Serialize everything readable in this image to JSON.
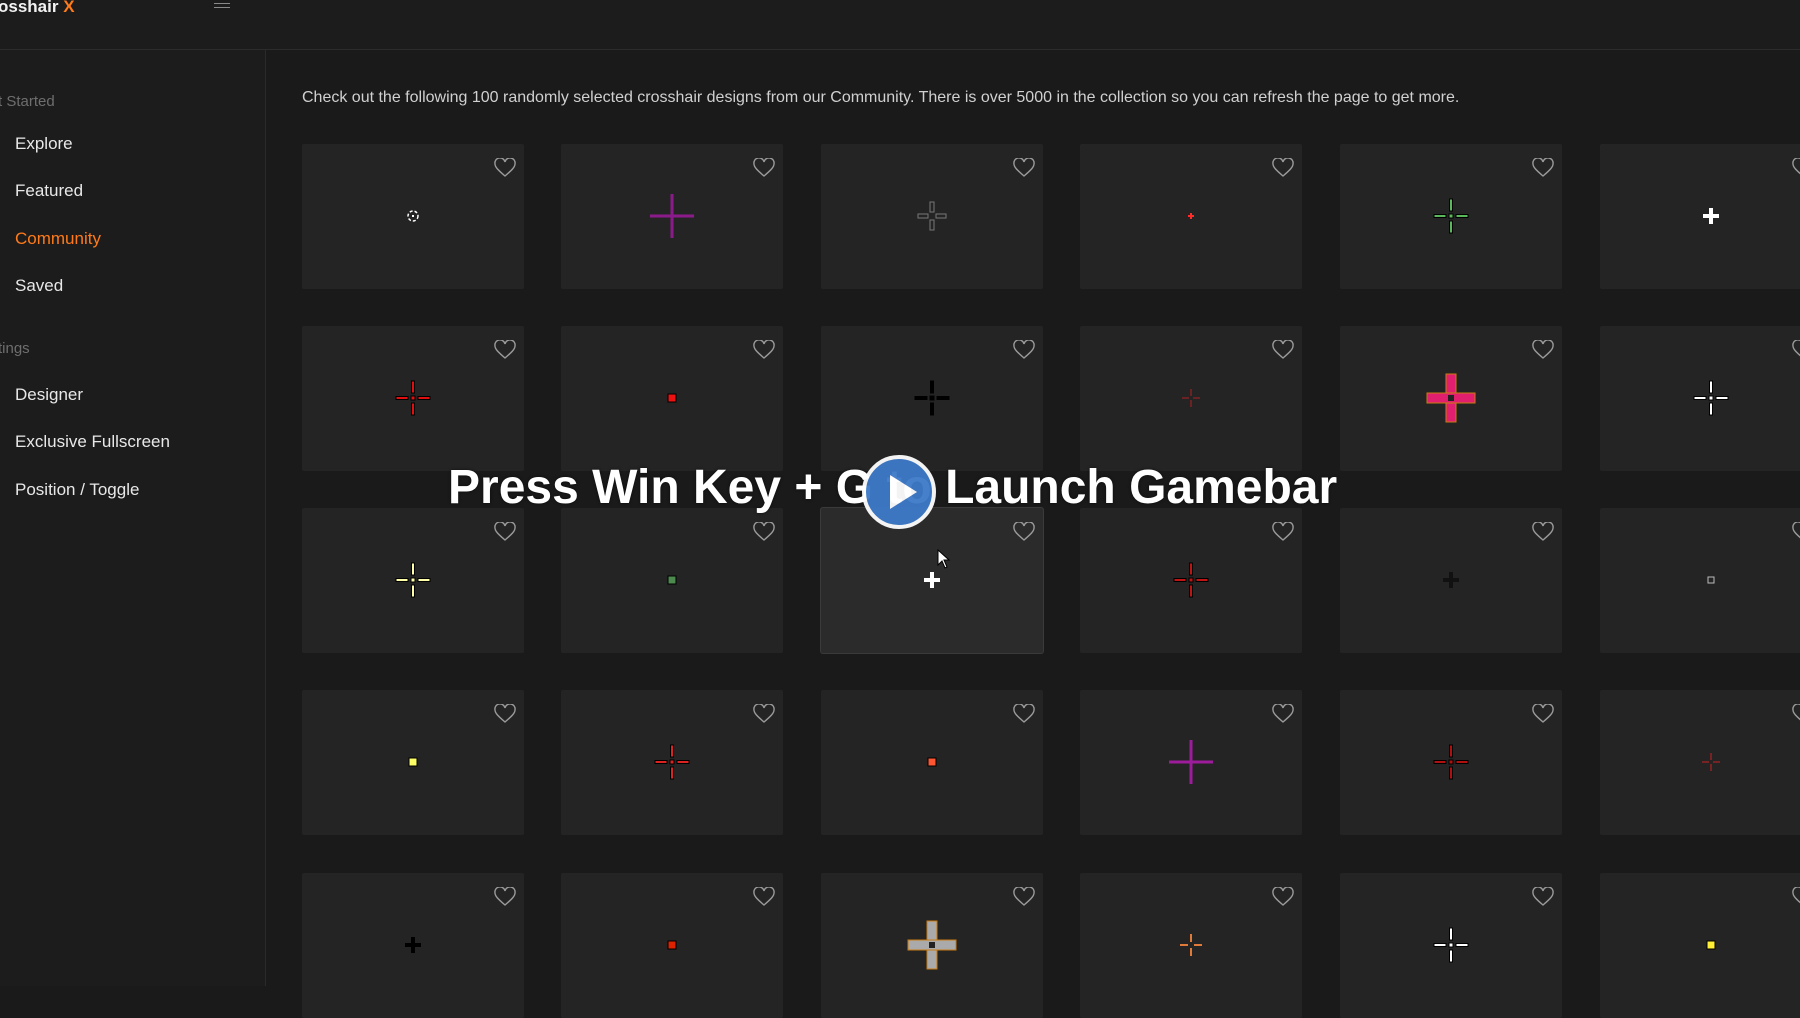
{
  "app": {
    "brand_main": "osshair",
    "brand_accent": "X"
  },
  "sidebar": {
    "section_started": "t Started",
    "section_settings": "tings",
    "items": [
      {
        "label": "Explore"
      },
      {
        "label": "Featured"
      },
      {
        "label": "Community",
        "active": true
      },
      {
        "label": "Saved"
      },
      {
        "label": "Designer"
      },
      {
        "label": "Exclusive Fullscreen"
      },
      {
        "label": "Position / Toggle"
      }
    ]
  },
  "main": {
    "intro": "Check out the following 100 randomly selected crosshair designs from our Community. There is over 5000 in the collection so you can refresh the page to get more.",
    "grid": {
      "rows": [
        [
          {
            "style": "circle",
            "color": "#ffffff"
          },
          {
            "style": "plus",
            "color": "#8b1a8b"
          },
          {
            "style": "outline-plus",
            "color": "#777777"
          },
          {
            "style": "tiny",
            "color": "#ff2a2a"
          },
          {
            "style": "plus-gap-dot",
            "color": "#5cb85c"
          },
          {
            "style": "solid",
            "color": "#ffffff"
          }
        ],
        [
          {
            "style": "plus-gap-dot",
            "color": "#e01010"
          },
          {
            "style": "square",
            "color": "#ee1111"
          },
          {
            "style": "plus-gap-dot",
            "color": "#000000"
          },
          {
            "style": "thin-plus",
            "color": "#b02020"
          },
          {
            "style": "thick-box",
            "color": "#e0206e"
          },
          {
            "style": "plus-gap-dot",
            "color": "#ffffff"
          }
        ],
        [
          {
            "style": "plus-gap-dot",
            "color": "#ffffaa"
          },
          {
            "style": "square",
            "color": "#4d8a4d"
          },
          {
            "style": "solid",
            "color": "#ffffff"
          },
          {
            "style": "plus-gap-dot",
            "color": "#c01515"
          },
          {
            "style": "solid",
            "color": "#111111"
          },
          {
            "style": "hollow-square",
            "color": "#bbbbbb"
          }
        ],
        [
          {
            "style": "square",
            "color": "#ffff66"
          },
          {
            "style": "plus-gap-dot",
            "color": "#dd2222"
          },
          {
            "style": "square",
            "color": "#ff5533"
          },
          {
            "style": "plus",
            "color": "#9c1c9c"
          },
          {
            "style": "plus-gap-dot",
            "color": "#b01010"
          },
          {
            "style": "thin-plus",
            "color": "#cc2222"
          }
        ],
        [
          {
            "style": "solid",
            "color": "#000000"
          },
          {
            "style": "square",
            "color": "#dd2200"
          },
          {
            "style": "thick-box",
            "color": "#aaaaaa"
          },
          {
            "style": "plus-gap",
            "color": "#e07a3a"
          },
          {
            "style": "plus-gap-dot",
            "color": "#ffffff"
          },
          {
            "style": "square",
            "color": "#ffee33"
          }
        ]
      ]
    }
  },
  "overlay": {
    "text": "Press Win Key + G to Launch Gamebar"
  },
  "colors": {
    "accent": "#ff7a1a",
    "card": "#242424",
    "background": "#1a1a1a"
  }
}
